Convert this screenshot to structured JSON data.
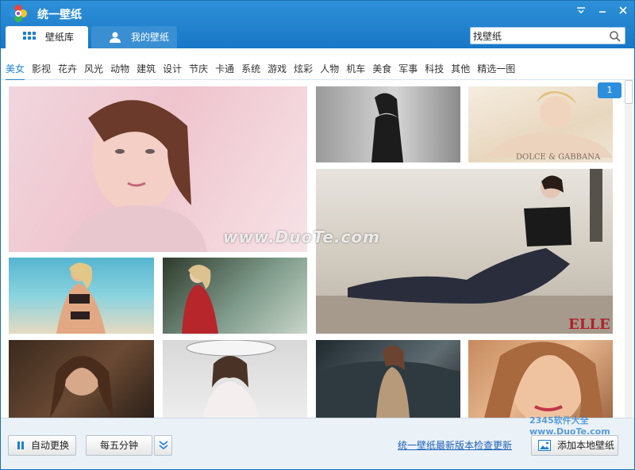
{
  "app": {
    "title": "统一壁纸"
  },
  "tabs": [
    {
      "label": "壁纸库"
    },
    {
      "label": "我的壁纸"
    }
  ],
  "search": {
    "value": "找壁纸"
  },
  "categories": [
    "美女",
    "影视",
    "花卉",
    "风光",
    "动物",
    "建筑",
    "设计",
    "节庆",
    "卡通",
    "系统",
    "游戏",
    "炫彩",
    "人物",
    "机车",
    "美食",
    "军事",
    "科技",
    "其他",
    "精选一图"
  ],
  "content": {
    "watermark": "www.DuoTe.com",
    "page_number": "1",
    "thumbnail_text": {
      "elle": "ELLE",
      "dg": "DOLCE & GABBANA"
    }
  },
  "bottom": {
    "auto_change_label": "自动更换",
    "interval_label": "每五分钟",
    "update_link": "统一壁纸最新版本检查更新",
    "add_local_label": "添加本地壁纸",
    "corner_logo": "2345软件大全  www.DuoTe.com"
  },
  "colors": {
    "title_bar": "#1e7fcf",
    "accent": "#1e82d2",
    "link": "#1e62b8"
  }
}
